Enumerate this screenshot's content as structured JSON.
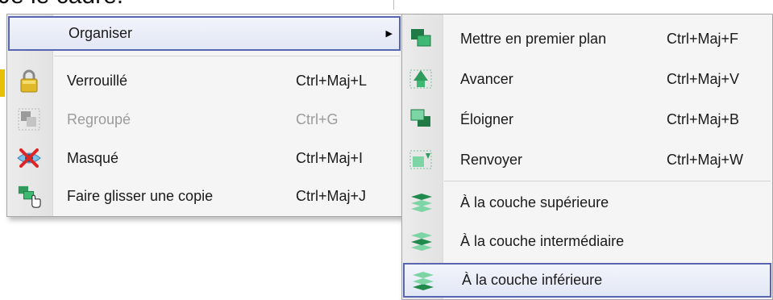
{
  "background": {
    "text": "Je le cadre."
  },
  "main_menu": {
    "items": [
      {
        "label": "Organiser",
        "shortcut": "",
        "has_submenu": true,
        "icon": "none"
      },
      {
        "label": "Verrouillé",
        "shortcut": "Ctrl+Maj+L",
        "icon": "padlock-icon"
      },
      {
        "label": "Regroupé",
        "shortcut": "Ctrl+G",
        "icon": "group-icon",
        "disabled": true
      },
      {
        "label": "Masqué",
        "shortcut": "Ctrl+Maj+I",
        "icon": "hidden-eye-icon"
      },
      {
        "label": "Faire glisser une copie",
        "shortcut": "Ctrl+Maj+J",
        "icon": "drag-copy-icon"
      }
    ],
    "submenu_arrow": "▶"
  },
  "arrange_submenu": {
    "items": [
      {
        "label": "Mettre en premier plan",
        "shortcut": "Ctrl+Maj+F",
        "icon": "bring-to-front-icon"
      },
      {
        "label": "Avancer",
        "shortcut": "Ctrl+Maj+V",
        "icon": "bring-forward-icon"
      },
      {
        "label": "Éloigner",
        "shortcut": "Ctrl+Maj+B",
        "icon": "send-to-back-icon"
      },
      {
        "label": "Renvoyer",
        "shortcut": "Ctrl+Maj+W",
        "icon": "send-backward-icon"
      },
      {
        "label": "À la couche supérieure",
        "shortcut": "",
        "icon": "layers-top-icon"
      },
      {
        "label": "À la couche intermédiaire",
        "shortcut": "",
        "icon": "layers-middle-icon"
      },
      {
        "label": "À la couche inférieure",
        "shortcut": "",
        "icon": "layers-bottom-icon",
        "highlighted": true
      }
    ]
  },
  "colors": {
    "highlight_border": "#5866b2",
    "icon_green": "#2e9a5c",
    "disabled_text": "#9b9b9b"
  }
}
